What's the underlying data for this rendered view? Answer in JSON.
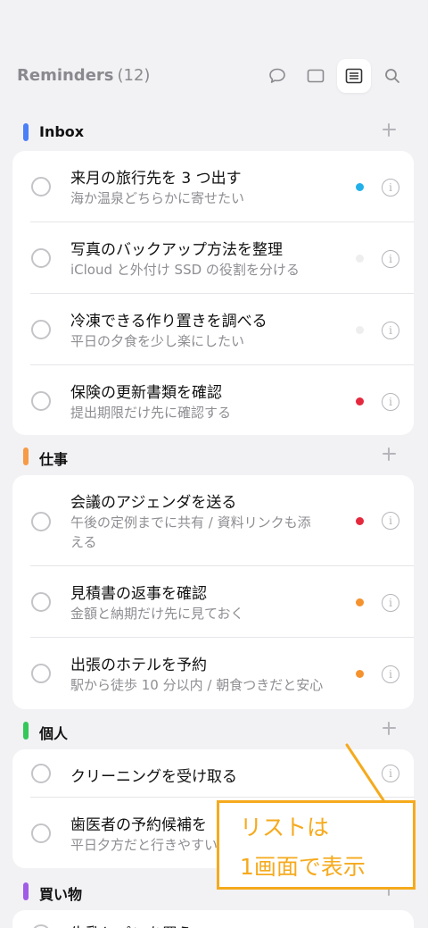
{
  "header": {
    "title": "Reminders",
    "count": "(12)",
    "icons": [
      "chat-bubble-icon",
      "card-view-icon",
      "list-view-icon",
      "search-icon"
    ]
  },
  "sections": [
    {
      "title": "Inbox",
      "color": "#4a7ff7",
      "items": [
        {
          "title": "来月の旅行先を 3 つ出す",
          "subtitle": "海か温泉どちらかに寄せたい",
          "dot": "#22b0ea"
        },
        {
          "title": "写真のバックアップ方法を整理",
          "subtitle": "iCloud と外付け SSD の役割を分ける",
          "dot": "#eeeeef"
        },
        {
          "title": "冷凍できる作り置きを調べる",
          "subtitle": "平日の夕食を少し楽にしたい",
          "dot": "#eeeeef"
        },
        {
          "title": "保険の更新書類を確認",
          "subtitle": "提出期限だけ先に確認する",
          "dot": "#e5283e"
        }
      ]
    },
    {
      "title": "仕事",
      "color": "#f79a45",
      "items": [
        {
          "title": "会議のアジェンダを送る",
          "subtitle": "午後の定例までに共有 / 資料リンクも添える",
          "dot": "#e5283e"
        },
        {
          "title": "見積書の返事を確認",
          "subtitle": "金額と納期だけ先に見ておく",
          "dot": "#f5922e"
        },
        {
          "title": "出張のホテルを予約",
          "subtitle": "駅から徒歩 10 分以内 / 朝食つきだと安心",
          "dot": "#f5922e"
        }
      ]
    },
    {
      "title": "個人",
      "color": "#34c759",
      "items": [
        {
          "title": "クリーニングを受け取る",
          "subtitle": "",
          "dot": ""
        },
        {
          "title": "歯医者の予約候補を",
          "subtitle": "平日夕方だと行きやすい",
          "dot": ""
        }
      ]
    },
    {
      "title": "買い物",
      "color": "#a05ce6",
      "items": [
        {
          "title": "牛乳とパンを買う",
          "subtitle": "",
          "dot": ""
        }
      ]
    }
  ],
  "callout": {
    "line1": "リストは",
    "line2": "1画面で表示",
    "color": "#f5aa1d"
  }
}
